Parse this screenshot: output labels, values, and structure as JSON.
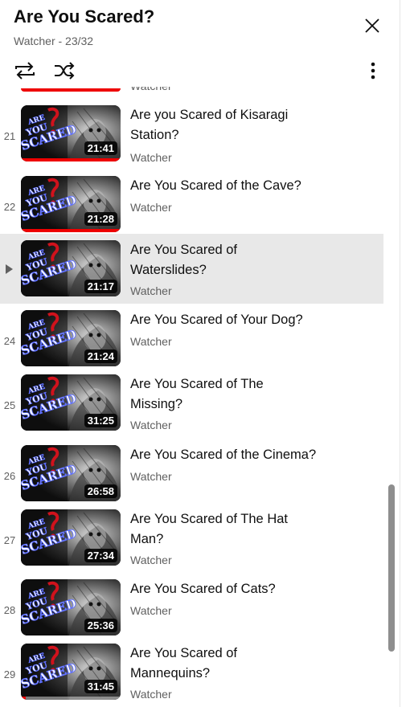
{
  "header": {
    "title": "Are You Scared?",
    "subtitle": "Watcher - 23/32",
    "icons": {
      "close": "close-icon",
      "loop": "loop-icon",
      "shuffle": "shuffle-icon",
      "more": "more-vert-icon"
    }
  },
  "prev": {
    "channel": "Watcher"
  },
  "items": [
    {
      "index": "21",
      "title_lines": [
        "Are you Scared of Kisaragi",
        "Station?"
      ],
      "channel": "Watcher",
      "duration": "21:41",
      "watched": 1.0,
      "active": false
    },
    {
      "index": "22",
      "title_lines": [
        "Are You Scared of the Cave?"
      ],
      "channel": "Watcher",
      "duration": "21:28",
      "watched": 1.0,
      "active": false
    },
    {
      "index": "",
      "title_lines": [
        "Are You Scared of",
        "Waterslides?"
      ],
      "channel": "Watcher",
      "duration": "21:17",
      "watched": 0,
      "active": true
    },
    {
      "index": "24",
      "title_lines": [
        "Are You Scared of Your Dog?"
      ],
      "channel": "Watcher",
      "duration": "21:24",
      "watched": 0,
      "active": false
    },
    {
      "index": "25",
      "title_lines": [
        "Are You Scared of The",
        "Missing?"
      ],
      "channel": "Watcher",
      "duration": "31:25",
      "watched": 0,
      "active": false
    },
    {
      "index": "26",
      "title_lines": [
        "Are You Scared of the Cinema?"
      ],
      "channel": "Watcher",
      "duration": "26:58",
      "watched": 0,
      "active": false
    },
    {
      "index": "27",
      "title_lines": [
        "Are You Scared of The Hat",
        "Man?"
      ],
      "channel": "Watcher",
      "duration": "27:34",
      "watched": 0,
      "active": false
    },
    {
      "index": "28",
      "title_lines": [
        "Are You Scared of Cats?"
      ],
      "channel": "Watcher",
      "duration": "25:36",
      "watched": 0,
      "active": false
    },
    {
      "index": "29",
      "title_lines": [
        "Are You Scared of",
        "Mannequins?"
      ],
      "channel": "Watcher",
      "duration": "31:45",
      "watched": 0.05,
      "active": false
    }
  ],
  "thumbnail_logo": {
    "line1": "ARE",
    "line2": "YOU",
    "line3": "SCARED"
  },
  "colors": {
    "progress": "#ee0000",
    "active_row": "#e8e8e8",
    "logo_blue": "#5b6cff",
    "logo_red": "#d0121c"
  }
}
